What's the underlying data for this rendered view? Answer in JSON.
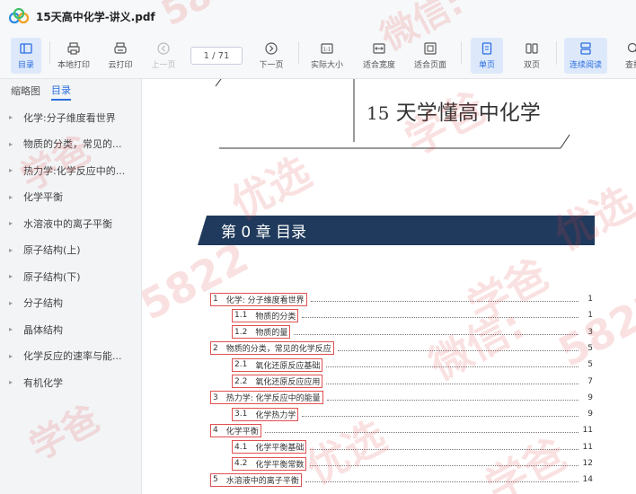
{
  "window": {
    "title": "15天高中化学-讲义.pdf"
  },
  "toolbar": {
    "toc_label": "目录",
    "local_print_label": "本地打印",
    "cloud_print_label": "云打印",
    "prev_page_label": "上一页",
    "page_indicator": "1 / 71",
    "next_page_label": "下一页",
    "actual_size_label": "实际大小",
    "fit_width_label": "适合宽度",
    "fit_page_label": "适合页面",
    "single_page_label": "单页",
    "double_page_label": "双页",
    "continuous_label": "连续阅读",
    "search_label": "查找"
  },
  "sidebar": {
    "tab_thumbnails": "缩略图",
    "tab_toc": "目录",
    "items": [
      {
        "label": "化学:分子维度看世界"
      },
      {
        "label": "物质的分类，常见的..."
      },
      {
        "label": "热力学:化学反应中的..."
      },
      {
        "label": "化学平衡"
      },
      {
        "label": "水溶液中的离子平衡"
      },
      {
        "label": "原子结构(上)"
      },
      {
        "label": "原子结构(下)"
      },
      {
        "label": "分子结构"
      },
      {
        "label": "晶体结构"
      },
      {
        "label": "化学反应的速率与能..."
      },
      {
        "label": "有机化学"
      }
    ]
  },
  "document": {
    "book_title_num": "15",
    "book_title_text": "天学懂高中化学",
    "chapter_heading": "第 0 章   目录",
    "toc": [
      {
        "no": "1",
        "title": "化学: 分子维度看世界",
        "page": "1",
        "level": 1
      },
      {
        "no": "1.1",
        "title": "物质的分类",
        "page": "1",
        "level": 2
      },
      {
        "no": "1.2",
        "title": "物质的量",
        "page": "3",
        "level": 2
      },
      {
        "no": "2",
        "title": "物质的分类，常见的化学反应",
        "page": "5",
        "level": 1
      },
      {
        "no": "2.1",
        "title": "氧化还原反应基础",
        "page": "5",
        "level": 2
      },
      {
        "no": "2.2",
        "title": "氧化还原反应应用",
        "page": "7",
        "level": 2
      },
      {
        "no": "3",
        "title": "热力学: 化学反应中的能量",
        "page": "9",
        "level": 1
      },
      {
        "no": "3.1",
        "title": "化学热力学",
        "page": "9",
        "level": 2
      },
      {
        "no": "4",
        "title": "化学平衡",
        "page": "11",
        "level": 1
      },
      {
        "no": "4.1",
        "title": "化学平衡基础",
        "page": "11",
        "level": 2
      },
      {
        "no": "4.2",
        "title": "化学平衡常数",
        "page": "12",
        "level": 2
      },
      {
        "no": "5",
        "title": "水溶液中的离子平衡",
        "page": "14",
        "level": 1
      }
    ]
  },
  "watermark": {
    "text_a": "学爸",
    "text_b": "微信:",
    "text_c": "58",
    "text_d": "优选",
    "text_e": "5822"
  },
  "colors": {
    "accent": "#2a6de0",
    "banner": "#1f3a5c",
    "toc_box": "#e05050"
  }
}
